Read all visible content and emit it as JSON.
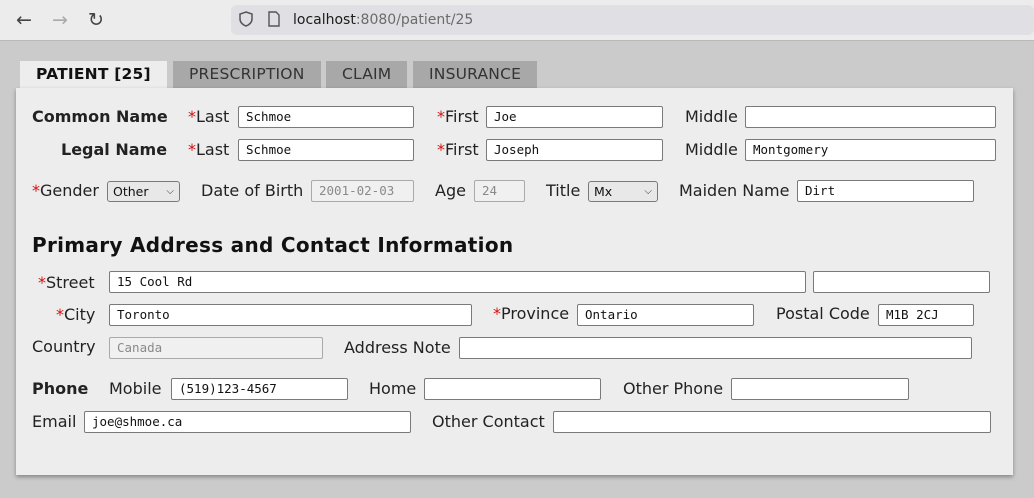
{
  "browser": {
    "back_icon": "←",
    "forward_icon": "→",
    "reload_icon": "↻",
    "url_host": "localhost",
    "url_rest": ":8080/patient/25"
  },
  "tabs": [
    "PATIENT [25]",
    "PRESCRIPTION",
    "CLAIM",
    "INSURANCE"
  ],
  "form": {
    "common_name_label": "Common Name",
    "legal_name_label": "Legal Name",
    "required_mark": "*",
    "last_label": "Last",
    "first_label": "First",
    "middle_label": "Middle",
    "common": {
      "last": "Schmoe",
      "first": "Joe",
      "middle": ""
    },
    "legal": {
      "last": "Schmoe",
      "first": "Joseph",
      "middle": "Montgomery"
    },
    "gender_label": "Gender",
    "gender": "Other",
    "dob_label": "Date of Birth",
    "dob": "2001-02-03",
    "age_label": "Age",
    "age": "24",
    "title_label": "Title",
    "title": "Mx",
    "maiden_label": "Maiden Name",
    "maiden": "Dirt",
    "section_title": "Primary Address and Contact Information",
    "street_label": "Street",
    "street": "15 Cool Rd",
    "street2": "",
    "city_label": "City",
    "city": "Toronto",
    "province_label": "Province",
    "province": "Ontario",
    "postal_label": "Postal Code",
    "postal": "M1B 2CJ",
    "country_label": "Country",
    "country": "Canada",
    "address_note_label": "Address Note",
    "address_note": "",
    "phone_label": "Phone",
    "mobile_label": "Mobile",
    "mobile": "(519)123-4567",
    "home_label": "Home",
    "home": "",
    "other_phone_label": "Other Phone",
    "other_phone": "",
    "email_label": "Email",
    "email": "joe@shmoe.ca",
    "other_contact_label": "Other Contact",
    "other_contact": ""
  }
}
